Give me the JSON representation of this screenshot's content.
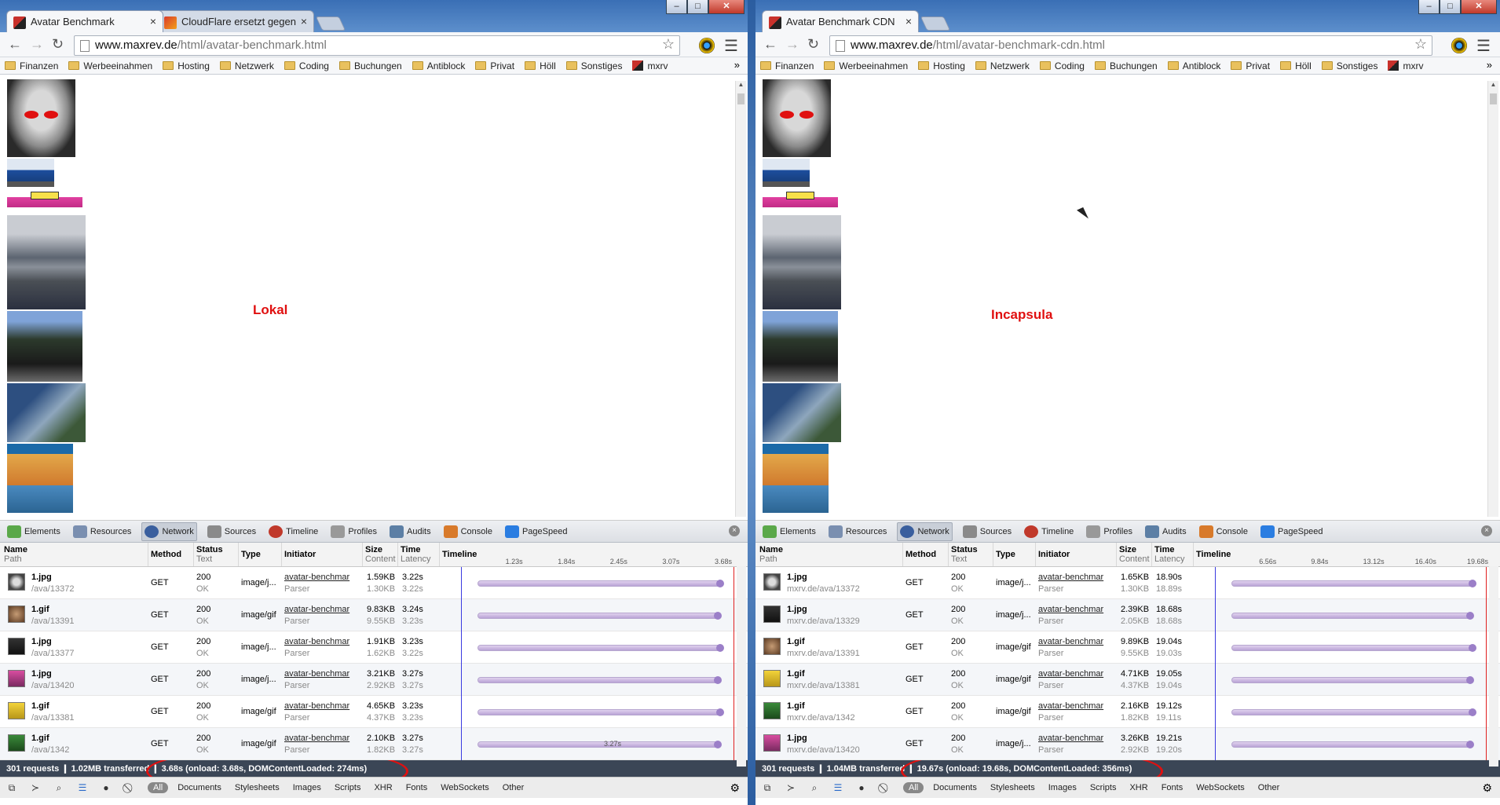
{
  "left": {
    "tabs": [
      {
        "title": "Avatar Benchmark",
        "active": true,
        "favicon": "avatar"
      },
      {
        "title": "CloudFlare ersetzt gegen",
        "active": false,
        "favicon": "cf"
      }
    ],
    "url": {
      "host": "www.maxrev.de",
      "path": "/html/avatar-benchmark.html"
    },
    "page_label": "Lokal",
    "ticks": [
      "1.23s",
      "1.84s",
      "2.45s",
      "3.07s",
      "3.68s"
    ],
    "rows": [
      {
        "name": "1.jpg",
        "path": "/ava/13372",
        "method": "GET",
        "status": "200",
        "status_text": "OK",
        "type": "image/j...",
        "initiator": "avatar-benchmar",
        "initiator_sub": "Parser",
        "size": "1.59KB",
        "content": "1.30KB",
        "time": "3.22s",
        "latency": "3.22s",
        "thumb": "t-skull"
      },
      {
        "name": "1.gif",
        "path": "/ava/13391",
        "method": "GET",
        "status": "200",
        "status_text": "OK",
        "type": "image/gif",
        "initiator": "avatar-benchmar",
        "initiator_sub": "Parser",
        "size": "9.83KB",
        "content": "9.55KB",
        "time": "3.24s",
        "latency": "3.23s",
        "thumb": "t-brown"
      },
      {
        "name": "1.jpg",
        "path": "/ava/13377",
        "method": "GET",
        "status": "200",
        "status_text": "OK",
        "type": "image/j...",
        "initiator": "avatar-benchmar",
        "initiator_sub": "Parser",
        "size": "1.91KB",
        "content": "1.62KB",
        "time": "3.23s",
        "latency": "3.22s",
        "thumb": "t-dark"
      },
      {
        "name": "1.jpg",
        "path": "/ava/13420",
        "method": "GET",
        "status": "200",
        "status_text": "OK",
        "type": "image/j...",
        "initiator": "avatar-benchmar",
        "initiator_sub": "Parser",
        "size": "3.21KB",
        "content": "2.92KB",
        "time": "3.27s",
        "latency": "3.27s",
        "thumb": "t-pink"
      },
      {
        "name": "1.gif",
        "path": "/ava/13381",
        "method": "GET",
        "status": "200",
        "status_text": "OK",
        "type": "image/gif",
        "initiator": "avatar-benchmar",
        "initiator_sub": "Parser",
        "size": "4.65KB",
        "content": "4.37KB",
        "time": "3.23s",
        "latency": "3.23s",
        "thumb": "t-yellow"
      },
      {
        "name": "1.gif",
        "path": "/ava/1342",
        "method": "GET",
        "status": "200",
        "status_text": "OK",
        "type": "image/gif",
        "initiator": "avatar-benchmar",
        "initiator_sub": "Parser",
        "size": "2.10KB",
        "content": "1.82KB",
        "time": "3.27s",
        "latency": "3.27s",
        "thumb": "t-green"
      }
    ],
    "bar_label": "3.27s",
    "status": "301 requests  ❙  1.02MB transferred  ❙  3.68s (onload: 3.68s, DOMContentLoaded: 274ms)"
  },
  "right": {
    "tabs": [
      {
        "title": "Avatar Benchmark CDN",
        "active": true,
        "favicon": "avatar"
      }
    ],
    "url": {
      "host": "www.maxrev.de",
      "path": "/html/avatar-benchmark-cdn.html"
    },
    "page_label": "Incapsula",
    "ticks": [
      "6.56s",
      "9.84s",
      "13.12s",
      "16.40s",
      "19.68s"
    ],
    "rows": [
      {
        "name": "1.jpg",
        "path": "mxrv.de/ava/13372",
        "method": "GET",
        "status": "200",
        "status_text": "OK",
        "type": "image/j...",
        "initiator": "avatar-benchmar",
        "initiator_sub": "Parser",
        "size": "1.65KB",
        "content": "1.30KB",
        "time": "18.90s",
        "latency": "18.89s",
        "thumb": "t-skull"
      },
      {
        "name": "1.jpg",
        "path": "mxrv.de/ava/13329",
        "method": "GET",
        "status": "200",
        "status_text": "OK",
        "type": "image/j...",
        "initiator": "avatar-benchmar",
        "initiator_sub": "Parser",
        "size": "2.39KB",
        "content": "2.05KB",
        "time": "18.68s",
        "latency": "18.68s",
        "thumb": "t-dark"
      },
      {
        "name": "1.gif",
        "path": "mxrv.de/ava/13391",
        "method": "GET",
        "status": "200",
        "status_text": "OK",
        "type": "image/gif",
        "initiator": "avatar-benchmar",
        "initiator_sub": "Parser",
        "size": "9.89KB",
        "content": "9.55KB",
        "time": "19.04s",
        "latency": "19.03s",
        "thumb": "t-brown"
      },
      {
        "name": "1.gif",
        "path": "mxrv.de/ava/13381",
        "method": "GET",
        "status": "200",
        "status_text": "OK",
        "type": "image/gif",
        "initiator": "avatar-benchmar",
        "initiator_sub": "Parser",
        "size": "4.71KB",
        "content": "4.37KB",
        "time": "19.05s",
        "latency": "19.04s",
        "thumb": "t-yellow"
      },
      {
        "name": "1.gif",
        "path": "mxrv.de/ava/1342",
        "method": "GET",
        "status": "200",
        "status_text": "OK",
        "type": "image/gif",
        "initiator": "avatar-benchmar",
        "initiator_sub": "Parser",
        "size": "2.16KB",
        "content": "1.82KB",
        "time": "19.12s",
        "latency": "19.11s",
        "thumb": "t-green"
      },
      {
        "name": "1.jpg",
        "path": "mxrv.de/ava/13420",
        "method": "GET",
        "status": "200",
        "status_text": "OK",
        "type": "image/j...",
        "initiator": "avatar-benchmar",
        "initiator_sub": "Parser",
        "size": "3.26KB",
        "content": "2.92KB",
        "time": "19.21s",
        "latency": "19.20s",
        "thumb": "t-pink"
      }
    ],
    "status": "301 requests  ❙  1.04MB transferred  ❙  19.67s (onload: 19.68s, DOMContentLoaded: 356ms)"
  },
  "bookmarks": [
    {
      "label": "Finanzen",
      "icon": "folder-icon"
    },
    {
      "label": "Werbeeinahmen",
      "icon": "folder-icon"
    },
    {
      "label": "Hosting",
      "icon": "folder-icon"
    },
    {
      "label": "Netzwerk",
      "icon": "folder-icon"
    },
    {
      "label": "Coding",
      "icon": "folder-icon"
    },
    {
      "label": "Buchungen",
      "icon": "folder-icon"
    },
    {
      "label": "Antiblock",
      "icon": "folder-icon"
    },
    {
      "label": "Privat",
      "icon": "folder-icon"
    },
    {
      "label": "Höll",
      "icon": "folder-icon"
    },
    {
      "label": "Sonstiges",
      "icon": "folder-icon"
    },
    {
      "label": "mxrv",
      "icon": "site-favicon-icon"
    }
  ],
  "devtools_tabs": [
    "Elements",
    "Resources",
    "Network",
    "Sources",
    "Timeline",
    "Profiles",
    "Audits",
    "Console",
    "PageSpeed"
  ],
  "devtools_selected": "Network",
  "columns": {
    "name": "Name",
    "name_sub": "Path",
    "method": "Method",
    "status": "Status",
    "status_sub": "Text",
    "type": "Type",
    "initiator": "Initiator",
    "size": "Size",
    "size_sub": "Content",
    "time": "Time",
    "time_sub": "Latency",
    "timeline": "Timeline"
  },
  "filters": [
    "Documents",
    "Stylesheets",
    "Images",
    "Scripts",
    "XHR",
    "Fonts",
    "WebSockets",
    "Other"
  ],
  "filter_all": "All",
  "colors": {
    "annotation_red": "#e01010",
    "devtools_status_bg": "#3b4656",
    "timeline_bar": "#b9a3d6"
  }
}
